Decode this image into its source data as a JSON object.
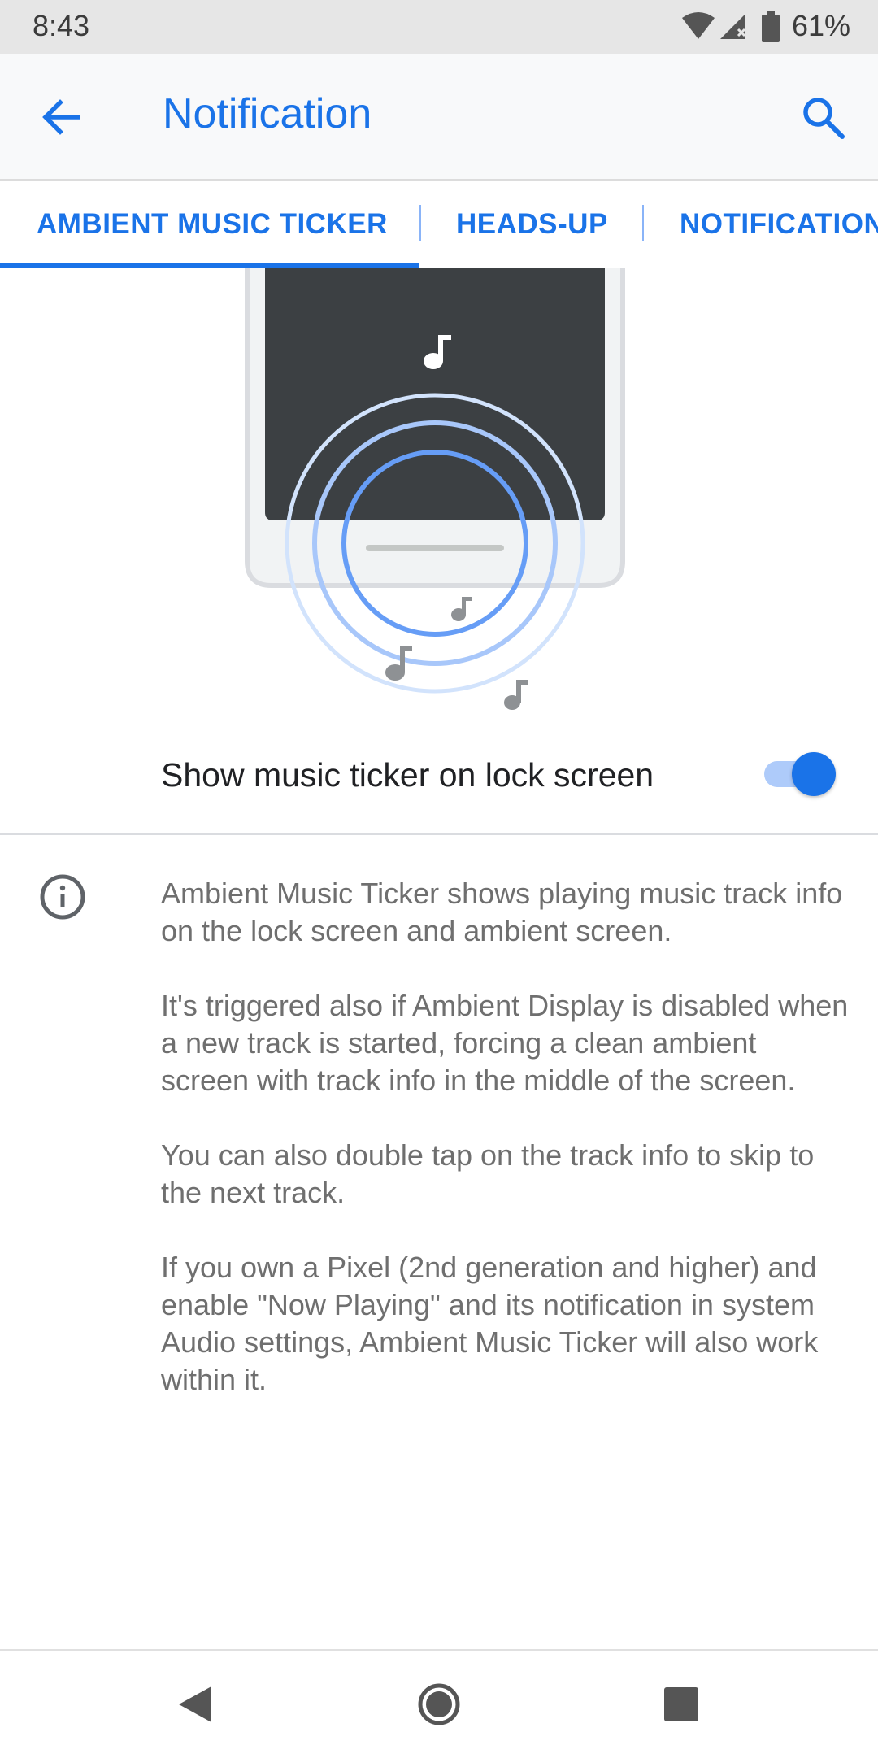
{
  "status_bar": {
    "time": "8:43",
    "battery": "61%",
    "icons": [
      "wifi-icon",
      "cell-signal-icon",
      "battery-icon"
    ]
  },
  "app_bar": {
    "title": "Notification",
    "back_icon": "arrow-left-icon",
    "search_icon": "search-icon",
    "accent_color": "#1a73e8"
  },
  "tabs": [
    {
      "label": "AMBIENT MUSIC TICKER",
      "selected": true
    },
    {
      "label": "HEADS-UP",
      "selected": false
    },
    {
      "label": "NOTIFICATION",
      "selected": false
    }
  ],
  "setting": {
    "label": "Show music ticker on lock screen",
    "enabled": true
  },
  "info": {
    "icon": "info-icon",
    "paragraphs": [
      "Ambient Music Ticker shows playing music track info on the lock screen and ambient screen.",
      "It's triggered also if Ambient Display is disabled when a new track is started, forcing a clean ambient screen with track info in the middle of the screen.",
      "You can also double tap on the track info to skip to the next track.",
      "If you own a Pixel (2nd generation and higher) and enable \"Now Playing\" and its notification in system Audio settings, Ambient Music Ticker will also work within it."
    ]
  },
  "nav_bar": {
    "icons": [
      "back-triangle-icon",
      "home-circle-icon",
      "recents-square-icon"
    ]
  }
}
